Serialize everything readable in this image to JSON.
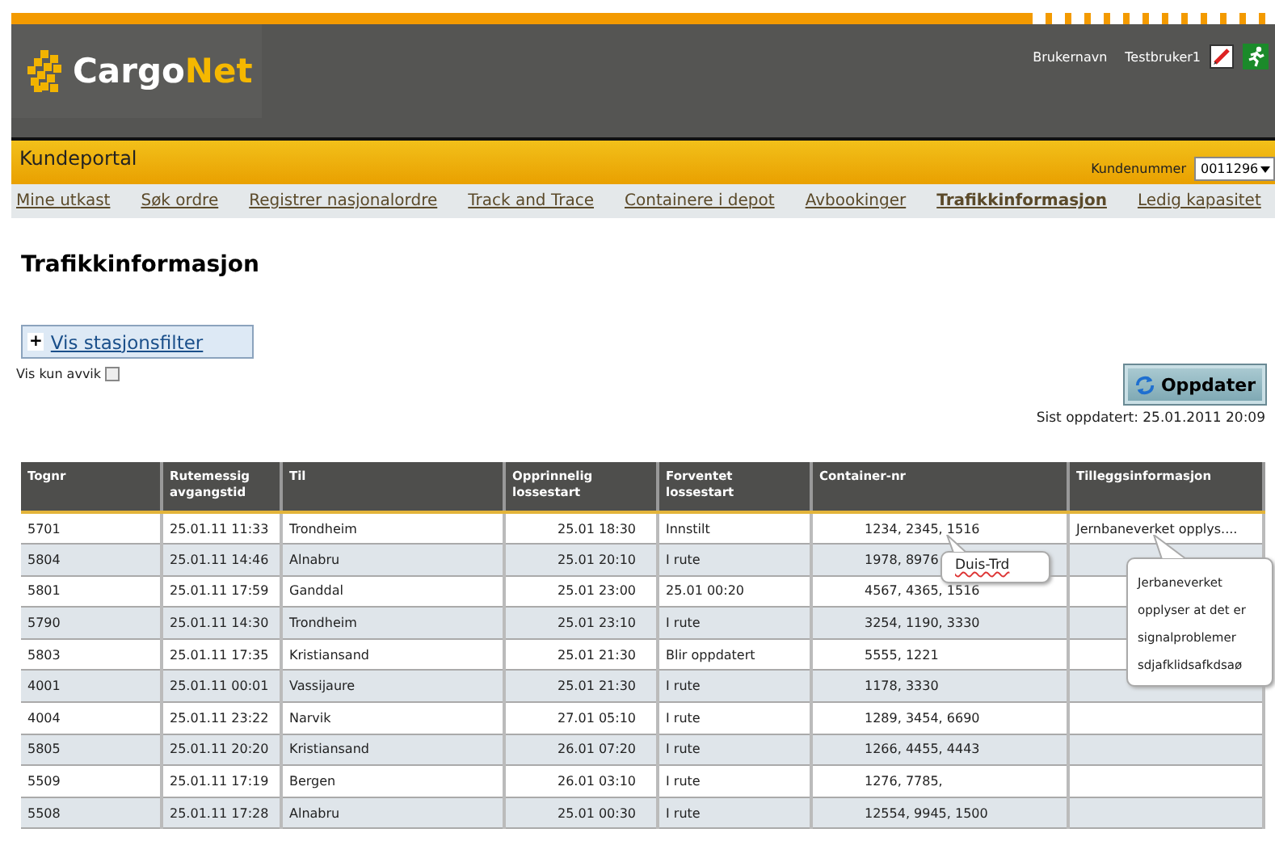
{
  "header": {
    "logo": [
      "Cargo",
      "Net"
    ],
    "user_label": "Brukernavn",
    "user_name": "Testbruker1"
  },
  "portal": {
    "title": "Kundeportal",
    "customer_label": "Kundenummer",
    "customer_value": "0011296"
  },
  "nav": [
    {
      "label": "Mine utkast",
      "selected": false
    },
    {
      "label": "Søk ordre",
      "selected": false
    },
    {
      "label": "Registrer nasjonalordre",
      "selected": false
    },
    {
      "label": "Track and Trace",
      "selected": false
    },
    {
      "label": "Containere i depot",
      "selected": false
    },
    {
      "label": "Avbookinger",
      "selected": false
    },
    {
      "label": "Trafikkinformasjon",
      "selected": true
    },
    {
      "label": "Ledig kapasitet",
      "selected": false
    }
  ],
  "page_title": "Trafikkinformasjon",
  "filter": {
    "toggle": "+",
    "label": "Vis stasjonsfilter"
  },
  "deviation_filter": {
    "label": "Vis kun avvik",
    "checked": false
  },
  "refresh_button": "Oppdater",
  "last_updated": "Sist oppdatert: 25.01.2011 20:09",
  "table": {
    "columns": [
      "Tognr",
      "Rutemessig avgangstid",
      "Til",
      "Opprinnelig lossestart",
      "Forventet lossestart",
      "Container-nr",
      "Tilleggsinformasjon"
    ],
    "rows": [
      [
        "5701",
        "25.01.11 11:33",
        "Trondheim",
        "25.01 18:30",
        "Innstilt",
        "1234, 2345, 1516",
        "Jernbaneverket opplys...."
      ],
      [
        "5804",
        "25.01.11 14:46",
        "Alnabru",
        "25.01 20:10",
        "I rute",
        "1978, 8976",
        ""
      ],
      [
        "5801",
        "25.01.11 17:59",
        "Ganddal",
        "25.01 23:00",
        "25.01 00:20",
        "4567, 4365, 1516",
        ""
      ],
      [
        "5790",
        "25.01.11 14:30",
        "Trondheim",
        "25.01 23:10",
        "I rute",
        "3254, 1190, 3330",
        ""
      ],
      [
        "5803",
        "25.01.11 17:35",
        "Kristiansand",
        "25.01 21:30",
        "Blir oppdatert",
        "5555, 1221",
        ""
      ],
      [
        "4001",
        "25.01.11 00:01",
        "Vassijaure",
        "25.01 21:30",
        "I rute",
        "1178, 3330",
        ""
      ],
      [
        "4004",
        "25.01.11 23:22",
        "Narvik",
        "27.01 05:10",
        "I rute",
        "1289, 3454, 6690",
        ""
      ],
      [
        "5805",
        "25.01.11 20:20",
        "Kristiansand",
        "26.01 07:20",
        "I rute",
        "1266, 4455, 4443",
        ""
      ],
      [
        "5509",
        "25.01.11 17:19",
        "Bergen",
        "26.01 03:10",
        "I rute",
        "1276, 7785,",
        ""
      ],
      [
        "5508",
        "25.01.11 17:28",
        "Alnabru",
        "25.01 00:30",
        "I rute",
        "12554, 9945, 1500",
        ""
      ]
    ]
  },
  "tooltips": [
    {
      "text": "Duis-Trd"
    },
    {
      "text": "Jerbaneverket opplyser at det er signalproblemer sdjafklidsafkdsaø"
    }
  ]
}
